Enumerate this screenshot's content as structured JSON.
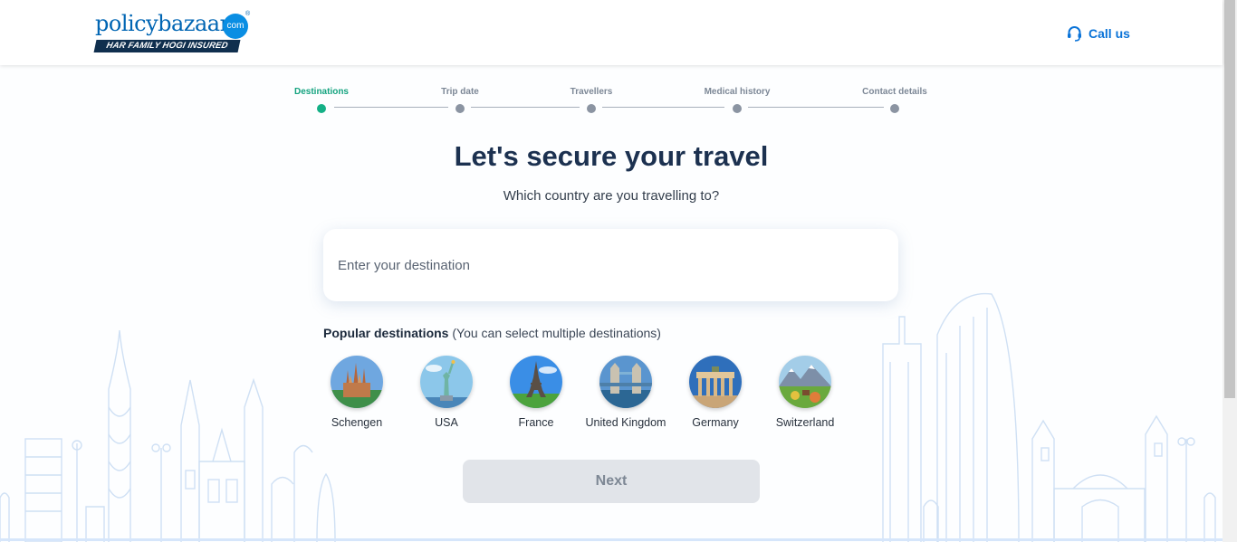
{
  "header": {
    "logo_policy": "policy",
    "logo_bazaar": "bazaar",
    "logo_com": "com",
    "logo_tagline": "HAR FAMILY HOGI INSURED",
    "call_label": "Call us"
  },
  "stepper": {
    "steps": [
      {
        "label": "Destinations",
        "active": true
      },
      {
        "label": "Trip date",
        "active": false
      },
      {
        "label": "Travellers",
        "active": false
      },
      {
        "label": "Medical history",
        "active": false
      },
      {
        "label": "Contact details",
        "active": false
      }
    ]
  },
  "main": {
    "title": "Let's secure your travel",
    "subtitle": "Which country are you travelling to?",
    "destination_placeholder": "Enter your destination",
    "destination_value": "",
    "popular_title": "Popular destinations",
    "popular_hint": "(You can select multiple destinations)",
    "destinations": [
      {
        "name": "Schengen",
        "icon": "sagrada-familia-icon"
      },
      {
        "name": "USA",
        "icon": "statue-of-liberty-icon"
      },
      {
        "name": "France",
        "icon": "eiffel-tower-icon"
      },
      {
        "name": "United Kingdom",
        "icon": "tower-bridge-icon"
      },
      {
        "name": "Germany",
        "icon": "brandenburg-gate-icon"
      },
      {
        "name": "Switzerland",
        "icon": "swiss-alps-icon"
      }
    ],
    "next_label": "Next"
  },
  "colors": {
    "accent_green": "#14b086",
    "brand_blue": "#0065b3",
    "call_blue": "#0a73d8",
    "title_navy": "#1c3150",
    "disabled_button": "#e1e4e9"
  }
}
